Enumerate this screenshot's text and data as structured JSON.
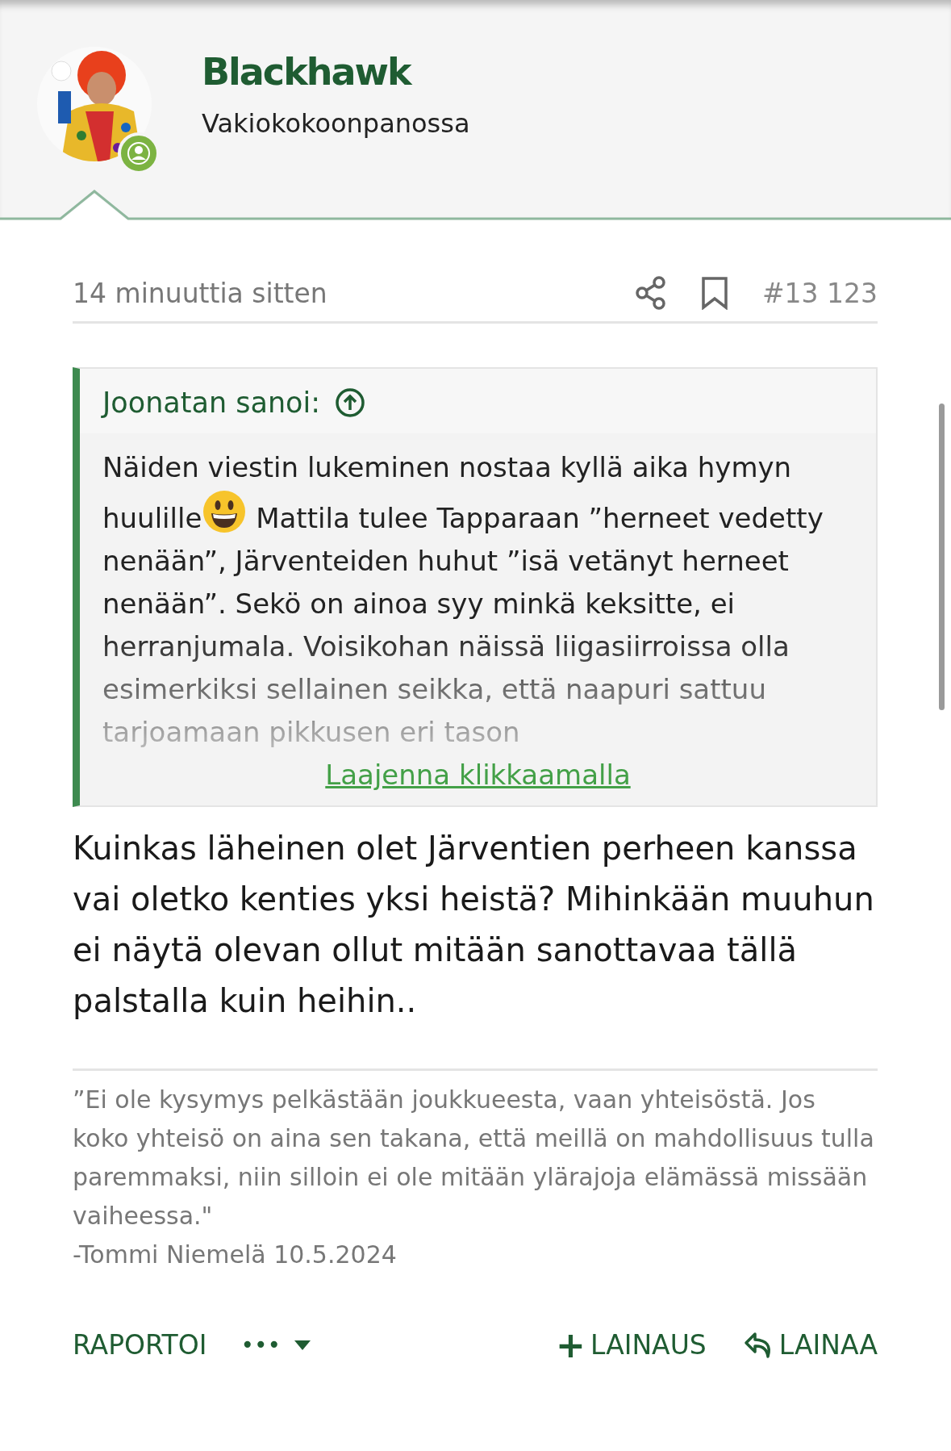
{
  "user": {
    "name": "Blackhawk",
    "title": "Vakiokokoonpanossa",
    "online": true
  },
  "post": {
    "time": "14 minuuttia sitten",
    "number": "#13 123",
    "quote": {
      "author": "Joonatan sanoi:",
      "text_before_emoji": "Näiden viestin lukeminen nostaa kyllä aika hymyn huulille",
      "text_after_emoji": " Mattila tulee Tapparaan ”herneet vedetty nenään”, Järventeiden huhut ”isä vetänyt herneet nenään”. Sekö on ainoa syy minkä keksitte, ei herranjumala. Voisikohan näissä liigasiirroissa olla esimerkiksi sellainen seikka, että naapuri sattuu tarjoamaan pikkusen eri tason",
      "expand": "Laajenna klikkaamalla"
    },
    "body": "Kuinkas läheinen olet Järventien perheen kanssa vai oletko kenties yksi heistä? Mihinkään muuhun ei näytä olevan ollut mitään sanottavaa tällä palstalla kuin heihin..",
    "signature": [
      "”Ei ole kysymys pelkästään joukkueesta, vaan yhteisöstä. Jos koko yhteisö on aina sen takana, että meillä on mahdollisuus tulla paremmaksi, niin silloin ei ole mitään ylärajoja elämässä missään vaiheessa.\"",
      "-Tommi Niemelä 10.5.2024"
    ]
  },
  "actions": {
    "report": "RAPORTOI",
    "more": "•••",
    "multiquote": "LAINAUS",
    "multiquote_sign": "+",
    "reply": "LAINAA"
  }
}
